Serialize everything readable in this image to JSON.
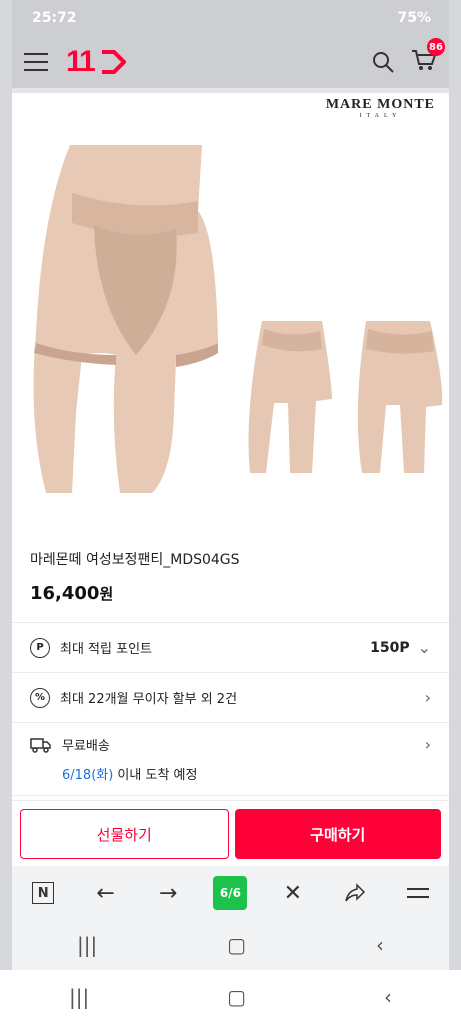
{
  "status": {
    "time": "25:72",
    "battery": "75%"
  },
  "appbar": {
    "logo": "11",
    "cart_count": "86"
  },
  "brand": {
    "name": "MARE MONTE",
    "country": "ITALY"
  },
  "product": {
    "title": "마레몬떼 여성보정팬티_MDS04GS",
    "price": "16,400",
    "currency": "원"
  },
  "benefits": [
    {
      "icon": "P",
      "label": "최대 적립 포인트",
      "value": "150P"
    },
    {
      "icon": "%",
      "label": "최대 22개월 무이자 할부 외 2건",
      "value": ""
    }
  ],
  "shipping": {
    "label": "무료배송",
    "date": "6/18(화)",
    "suffix": " 이내 도착 예정"
  },
  "cta": {
    "gift": "선물하기",
    "buy": "구매하기"
  },
  "browser": {
    "n_label": "N",
    "tabs_count": "6/6"
  }
}
